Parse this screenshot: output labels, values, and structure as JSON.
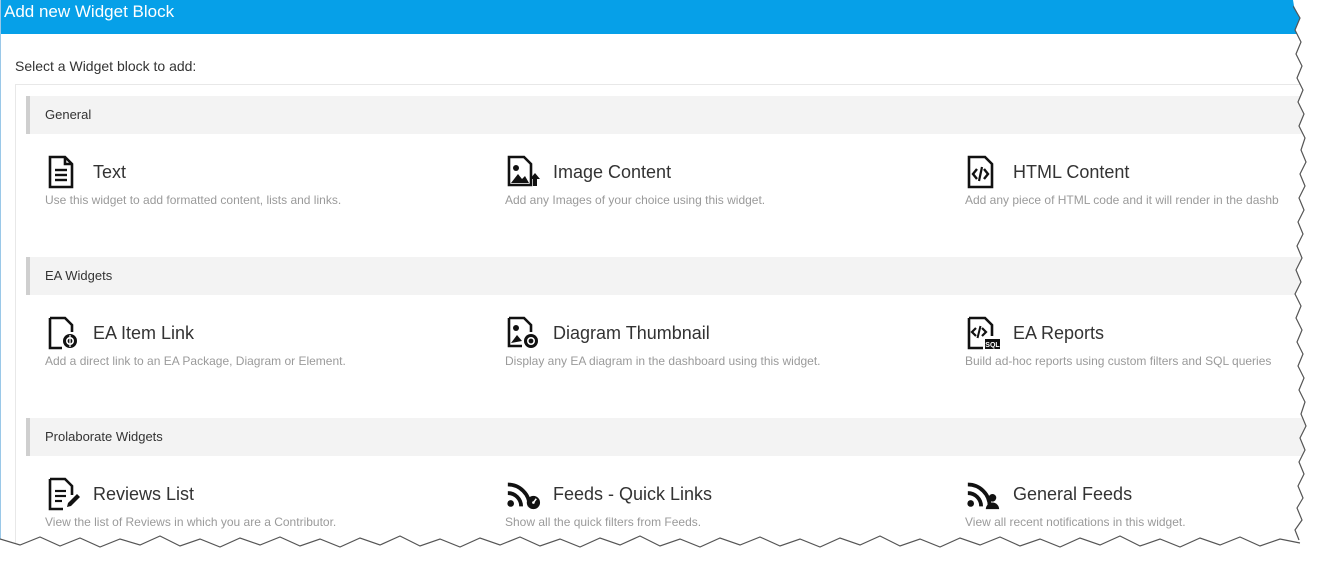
{
  "dialog": {
    "title": "Add new Widget Block",
    "prompt": "Select a Widget block to add:"
  },
  "sections": [
    {
      "label": "General",
      "widgets": [
        {
          "title": "Text",
          "desc": "Use this widget to add formatted content, lists and links.",
          "icon": "text-document-icon"
        },
        {
          "title": "Image Content",
          "desc": "Add any Images of your choice using this widget.",
          "icon": "image-upload-icon"
        },
        {
          "title": "HTML Content",
          "desc": "Add any piece of HTML code and it will render in the dashb",
          "icon": "html-code-icon"
        }
      ]
    },
    {
      "label": "EA Widgets",
      "widgets": [
        {
          "title": "EA Item Link",
          "desc": "Add a direct link to an EA Package, Diagram or Element.",
          "icon": "ea-item-link-icon"
        },
        {
          "title": "Diagram Thumbnail",
          "desc": "Display any EA diagram in the dashboard using this widget.",
          "icon": "diagram-thumbnail-icon"
        },
        {
          "title": "EA Reports",
          "desc": "Build ad-hoc reports using custom filters and SQL queries",
          "icon": "ea-reports-sql-icon"
        }
      ]
    },
    {
      "label": "Prolaborate Widgets",
      "widgets": [
        {
          "title": "Reviews List",
          "desc": "View the list of Reviews in which you are a Contributor.",
          "icon": "reviews-list-icon"
        },
        {
          "title": "Feeds - Quick Links",
          "desc": "Show all the quick filters from Feeds.",
          "icon": "feeds-quick-links-icon"
        },
        {
          "title": "General Feeds",
          "desc": "View all recent notifications in this widget.",
          "icon": "general-feeds-icon"
        }
      ]
    }
  ]
}
